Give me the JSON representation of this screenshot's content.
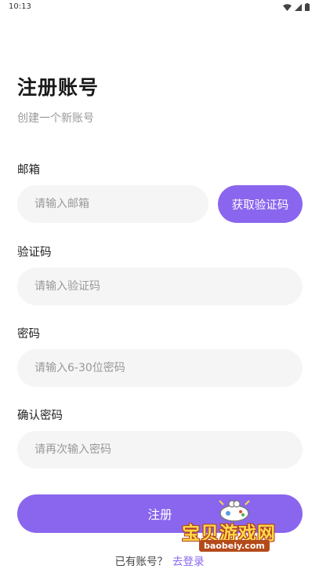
{
  "status_bar": {
    "time": "10:13",
    "icons": [
      "wifi-icon",
      "signal-icon",
      "battery-icon"
    ]
  },
  "header": {
    "title": "注册账号",
    "subtitle": "创建一个新账号"
  },
  "form": {
    "email": {
      "label": "邮箱",
      "placeholder": "请输入邮箱",
      "value": ""
    },
    "get_code_label": "获取验证码",
    "code": {
      "label": "验证码",
      "placeholder": "请输入验证码",
      "value": ""
    },
    "password": {
      "label": "密码",
      "placeholder": "请输入6-30位密码",
      "value": ""
    },
    "confirm_password": {
      "label": "确认密码",
      "placeholder": "请再次输入密码",
      "value": ""
    },
    "submit_label": "注册"
  },
  "footer": {
    "question": "已有账号？",
    "login_link": "去登录"
  },
  "watermark": {
    "text": "宝贝游戏网",
    "url": "baobeiy.com"
  },
  "colors": {
    "accent": "#8a66ee",
    "input_bg": "#f5f5f5",
    "muted": "#999999"
  }
}
